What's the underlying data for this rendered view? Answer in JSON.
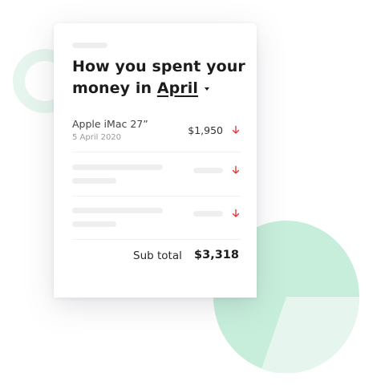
{
  "heading": {
    "prefix": "How you spent your money in",
    "month": "April"
  },
  "transactions": [
    {
      "name": "Apple iMac 27”",
      "date": "5 April 2020",
      "amount": "$1,950",
      "direction_icon": "arrow-down-icon"
    }
  ],
  "subtotal": {
    "label": "Sub total",
    "value": "$3,318"
  },
  "colors": {
    "accent_red": "#e0393e",
    "mint": "#c7eedb",
    "mint_light": "#e6f6ee",
    "text_dark": "#1c1c1c"
  },
  "icons": {
    "month_dropdown": "caret-down-icon",
    "amount_direction": "arrow-down-icon"
  }
}
